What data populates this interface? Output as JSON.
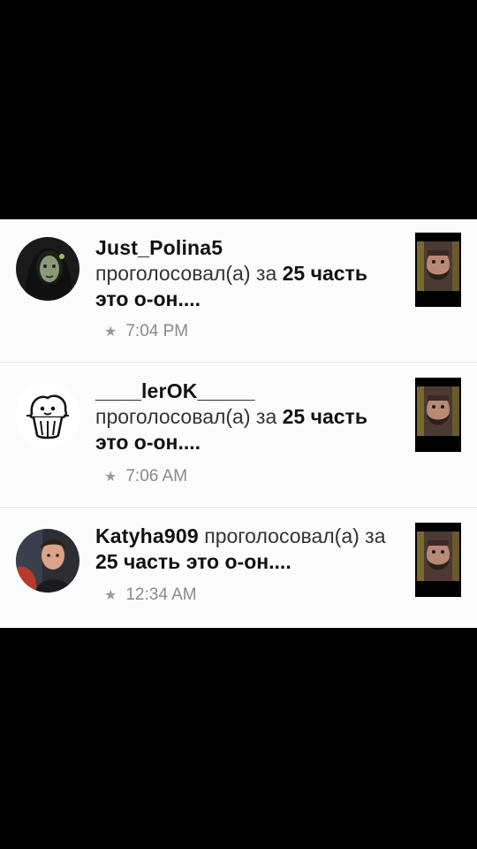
{
  "notifications": [
    {
      "username": "Just_Polina5",
      "verb": "проголосовал(а) за",
      "story": "25 часть это о-он....",
      "time": "7:04 PM",
      "star_icon": "star-icon"
    },
    {
      "username": "____lerOK_____",
      "verb": "проголосовал(а) за",
      "story": "25 часть это о-он....",
      "time": "7:06 AM",
      "star_icon": "star-icon"
    },
    {
      "username": "Katyha909",
      "verb": "проголосовал(а) за",
      "story": "25 часть это о-он....",
      "time": "12:34 AM",
      "star_icon": "star-icon"
    }
  ],
  "colors": {
    "background": "#000000",
    "panel": "#ffffff",
    "meta": "#8a8a8a"
  }
}
